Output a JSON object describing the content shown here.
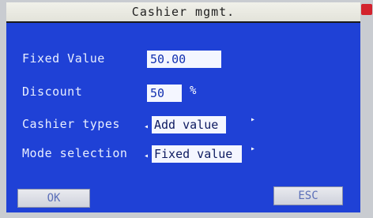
{
  "window": {
    "title": "Cashier mgmt."
  },
  "form": {
    "fixed_value": {
      "label": "Fixed Value",
      "value": "50.00"
    },
    "discount": {
      "label": "Discount",
      "value": "50",
      "unit": "%"
    },
    "cashier_types": {
      "label": "Cashier types",
      "selected": "Add value"
    },
    "mode_selection": {
      "label": "Mode selection",
      "selected": "Fixed value"
    }
  },
  "buttons": {
    "ok": "OK",
    "esc": "ESC"
  },
  "colors": {
    "screen_bg": "#1f41d6",
    "title_bg": "#eeeeea",
    "field_bg": "#f4f6ff",
    "button_bg": "#dcdfe8"
  }
}
